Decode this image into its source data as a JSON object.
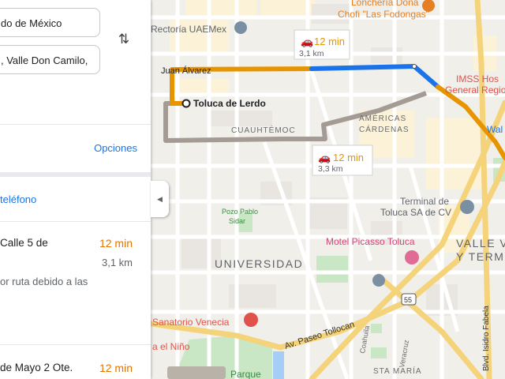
{
  "panel": {
    "origin_value": "do de México",
    "destination_value": ", Valle Don Camilo,",
    "swap_icon": "swap-vertical-icon",
    "options_label": "Opciones",
    "phone_label": "teléfono",
    "routes": [
      {
        "title": "Calle 5 de",
        "time": "12 min",
        "distance": "3,1 km",
        "note": "or ruta debido a las"
      },
      {
        "title": "de Mayo 2 Ote.",
        "time": "12 min"
      }
    ],
    "collapse_icon": "chevron-left-icon"
  },
  "map": {
    "accent_orange": "#e69500",
    "accent_blue": "#1a73e8",
    "alt_route_color": "#a8a19a",
    "bubbles": [
      {
        "time": "12 min",
        "distance": "3,1 km"
      },
      {
        "time": "12 min",
        "distance": "3,3 km"
      }
    ],
    "labels": {
      "loncheria": "Lonchería Doña",
      "chofi": "Chofi \"Las Fodongas\"",
      "rectoria": "Rectoría UAEMex",
      "juan_alvarez": "Juan Álvarez",
      "toluca_lerdo": "Toluca de Lerdo",
      "imss1": "IMSS Hos",
      "imss2": "General Regional",
      "cuauhtemoc": "CUAUHTÉMOC",
      "americas1": "AMÉRICAS",
      "americas2": "CÁRDENAS",
      "terminal1": "Terminal de",
      "terminal2": "Toluca SA de CV",
      "pozo1": "Pozo Pablo",
      "pozo2": "Sidar",
      "motel": "Motel Picasso Toluca",
      "universidad": "UNIVERSIDAD",
      "valle1": "VALLE V",
      "valle2": "Y TERM",
      "wal": "Wal",
      "sanatorio": "Sanatorio Venecia",
      "nino": "a el Niño",
      "paseo": "Av. Paseo Tollocan",
      "coahuila": "Coahuila",
      "veracruz": "Veracruz",
      "isidro": "Blvd. Isidro Fabela",
      "sta_maria": "STA MARÍA",
      "parque": "Parque",
      "shield": "55"
    }
  }
}
